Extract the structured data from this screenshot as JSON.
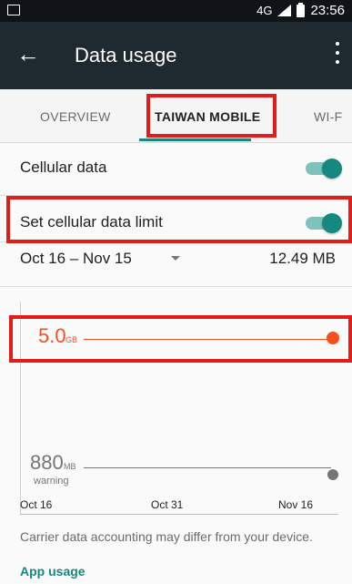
{
  "status_bar": {
    "network": "4G",
    "network_small": "4G",
    "time": "23:56",
    "icons": [
      "sim-icon",
      "signal-icon",
      "battery-icon"
    ]
  },
  "app_bar": {
    "title": "Data usage",
    "back_icon": "arrow-back-icon",
    "menu_icon": "more-vert-icon"
  },
  "tabs": [
    {
      "label": "OVERVIEW",
      "active": false
    },
    {
      "label": "TAIWAN MOBILE",
      "active": true
    },
    {
      "label": "WI-F",
      "active": false
    }
  ],
  "settings": {
    "cellular_data": {
      "label": "Cellular data",
      "enabled": true
    },
    "data_limit": {
      "label": "Set cellular data limit",
      "enabled": true
    }
  },
  "cycle": {
    "range": "Oct 16 – Nov 15",
    "usage": "12.49 MB"
  },
  "chart": {
    "limit": {
      "value": "5.0",
      "unit": "GB"
    },
    "warning": {
      "value": "880",
      "unit": "MB",
      "label": "warning"
    },
    "x_labels": [
      "Oct 16",
      "Oct 31",
      "Nov 16"
    ]
  },
  "note": "Carrier data accounting may differ from your device.",
  "app_usage_header": "App usage",
  "colors": {
    "accent": "#15897f",
    "limit": "#f4511e",
    "appbar": "#1e2a30",
    "highlight": "#e21b1b"
  }
}
